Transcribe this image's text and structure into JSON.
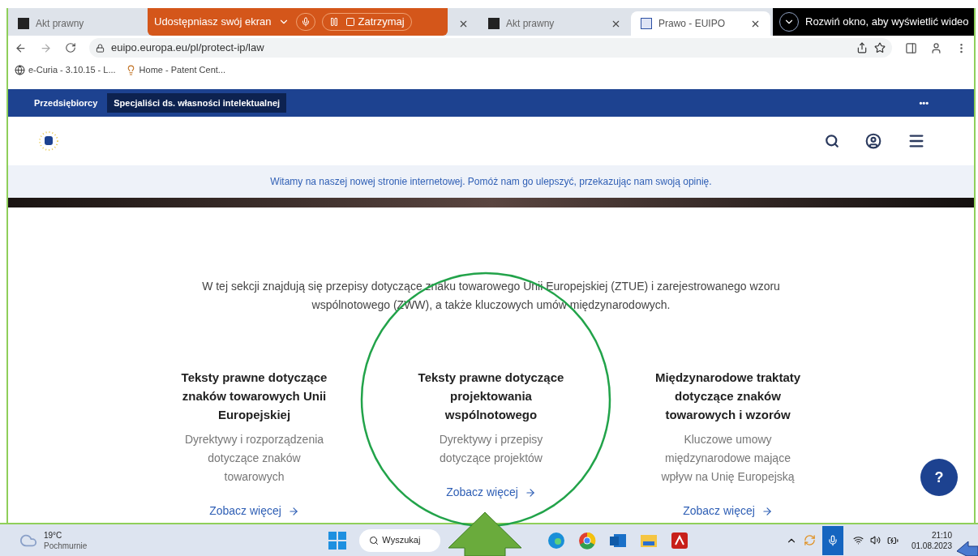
{
  "tabs": [
    {
      "title": "Akt prawny",
      "selected": false
    },
    {
      "title": "Akt prawny",
      "selected": false
    },
    {
      "title": "Prawo - EUIPO",
      "selected": true
    }
  ],
  "share_bar": {
    "label": "Udostępniasz swój ekran",
    "stop": "Zatrzymaj"
  },
  "video_popup": {
    "label": "Rozwiń okno, aby wyświetlić wideo"
  },
  "address": "euipo.europa.eu/pl/protect-ip/law",
  "bookmarks": [
    "e-Curia - 3.10.15 - L...",
    "Home - Patent Cent..."
  ],
  "site_nav": {
    "items": [
      {
        "label": "Przedsiębiorcy",
        "selected": false
      },
      {
        "label": "Specjaliści ds. własności intelektualnej",
        "selected": true
      }
    ],
    "more": "•••"
  },
  "banner": "Witamy na naszej nowej stronie internetowej. Pomóż nam go ulepszyć, przekazując nam swoją opinię.",
  "intro": "W tej sekcji znajdują się przepisy dotyczące znaku towarowego Unii Europejskiej (ZTUE) i zarejestrowanego wzoru wspólnotowego (ZWW), a także kluczowych umów międzynarodowych.",
  "cards": [
    {
      "title": "Teksty prawne dotyczące znaków towarowych Unii Europejskiej",
      "description": "Dyrektywy i rozporządzenia dotyczące znaków towarowych",
      "link": "Zobacz więcej"
    },
    {
      "title": "Teksty prawne dotyczące projektowania wspólnotowego",
      "description": "Dyrektywy i przepisy dotyczące projektów",
      "link": "Zobacz więcej"
    },
    {
      "title": "Międzynarodowe traktaty dotyczące znaków towarowych i wzorów",
      "description": "Kluczowe umowy międzynarodowe mające wpływ na Unię Europejską",
      "link": "Zobacz więcej"
    }
  ],
  "help": "?",
  "taskbar": {
    "temperature": "19°C",
    "condition": "Pochmurnie",
    "search": "Wyszukaj",
    "time": "21:10",
    "date": "01.08.2023"
  }
}
